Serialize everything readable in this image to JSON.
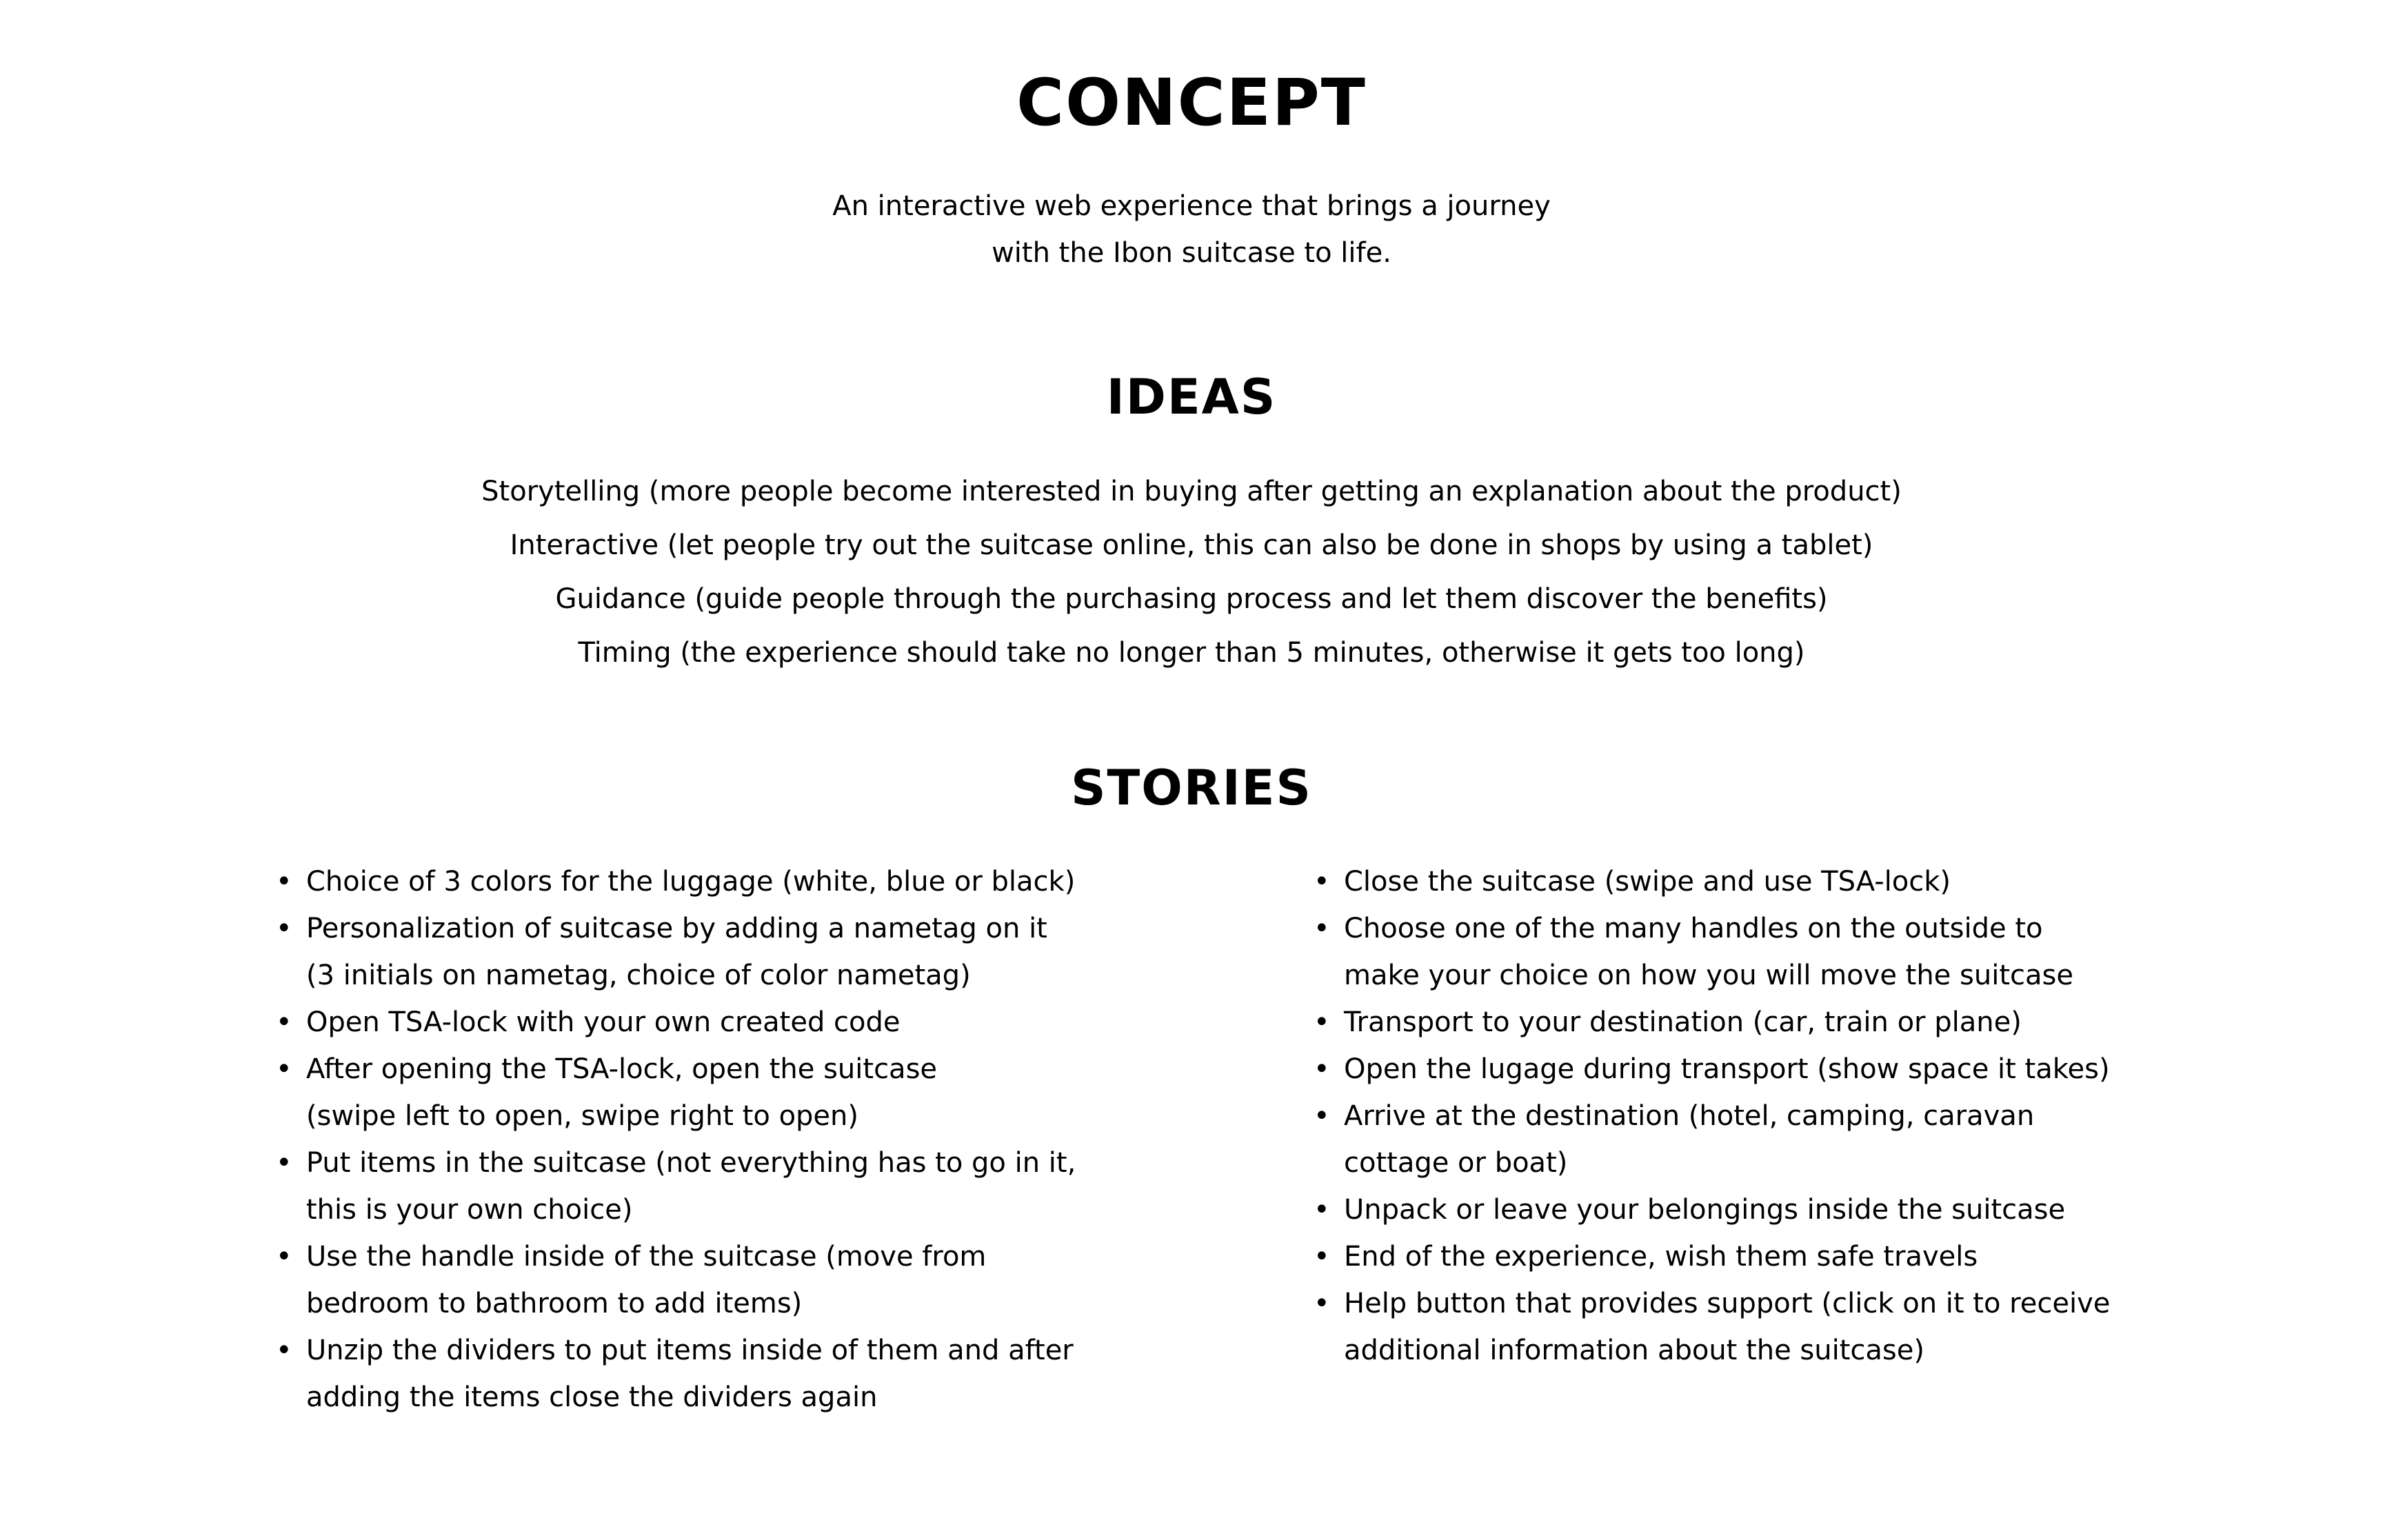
{
  "concept": {
    "heading": "CONCEPT",
    "tagline_line1": "An interactive web experience that brings a journey",
    "tagline_line2": "with the Ibon suitcase to life."
  },
  "ideas": {
    "heading": "IDEAS",
    "items": [
      "Storytelling (more people become interested in buying after getting an explanation about the product)",
      "Interactive (let people try out the suitcase online, this can also be done in shops by using a tablet)",
      "Guidance (guide people through the purchasing process and let them discover the benefits)",
      "Timing (the experience should take no longer than 5 minutes, otherwise it gets too long)"
    ]
  },
  "stories": {
    "heading": "STORIES",
    "left": [
      [
        "Choice of 3 colors for the luggage (white, blue or black)"
      ],
      [
        "Personalization of suitcase by adding a nametag on it",
        "(3 initials on nametag, choice of color nametag)"
      ],
      [
        "Open TSA-lock with your own created code"
      ],
      [
        "After opening the TSA-lock, open the suitcase",
        "(swipe left to open, swipe right to open)"
      ],
      [
        "Put items in the suitcase (not everything has to go in it,",
        "this is your own choice)"
      ],
      [
        "Use the handle inside of the suitcase (move from",
        "bedroom to bathroom to add items)"
      ],
      [
        "Unzip the dividers to put items inside of them and after",
        "adding the items close the dividers again"
      ]
    ],
    "right": [
      [
        "Close the suitcase (swipe and use TSA-lock)"
      ],
      [
        "Choose one of the many handles on the outside to",
        "make your choice on how you will move the suitcase"
      ],
      [
        "Transport to your destination (car, train or plane)"
      ],
      [
        "Open the lugage during transport (show space it takes)"
      ],
      [
        "Arrive at the destination (hotel, camping, caravan",
        "cottage or boat)"
      ],
      [
        "Unpack or leave your belongings inside the suitcase"
      ],
      [
        "End of the experience, wish them safe travels"
      ],
      [
        "Help button that provides support (click on it to receive",
        "additional information about the suitcase)"
      ]
    ]
  }
}
